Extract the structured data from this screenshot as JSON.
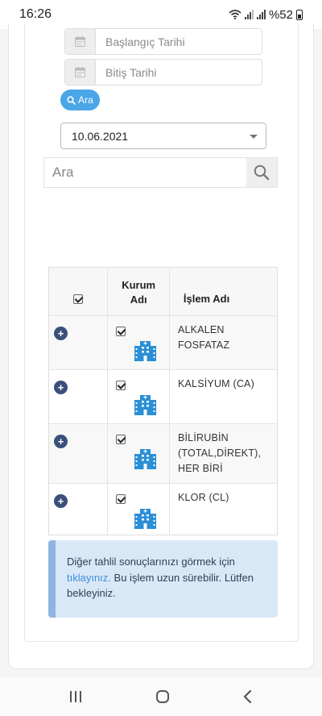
{
  "status": {
    "time": "16:26",
    "battery": "%52"
  },
  "filters": {
    "start_date_placeholder": "Başlangıç Tarihi",
    "end_date_placeholder": "Bitiş Tarihi",
    "search_button_label": "Ara",
    "selected_date": "10.06.2021",
    "search_placeholder": "Ara"
  },
  "table": {
    "headers": {
      "institution_line1": "Kurum",
      "institution_line2": "Adı",
      "operation": "İşlem Adı"
    },
    "rows": [
      {
        "name_lines": [
          "ALKALEN",
          "FOSFATAZ"
        ]
      },
      {
        "name_lines": [
          "KALSİYUM (CA)"
        ]
      },
      {
        "name_lines": [
          "BİLİRUBİN",
          "(TOTAL,DİREKT),",
          "HER BİRİ"
        ]
      },
      {
        "name_lines": [
          "KLOR (CL)"
        ]
      }
    ]
  },
  "alert": {
    "text_before": "Diğer tahlil sonuçlarınızı görmek için",
    "link_text": "tıklayınız.",
    "text_after": "Bu işlem uzun sürebilir. Lütfen bekleyiniz."
  },
  "colors": {
    "accent": "#4aa6e6",
    "plus_button": "#3a4f7a",
    "hospital_icon": "#2b8fd6",
    "alert_bg": "#d9e8f7"
  },
  "icons": {
    "calendar": "calendar-icon",
    "search": "search-icon",
    "plus": "plus-circle-icon",
    "institution": "hospital-building-icon"
  }
}
